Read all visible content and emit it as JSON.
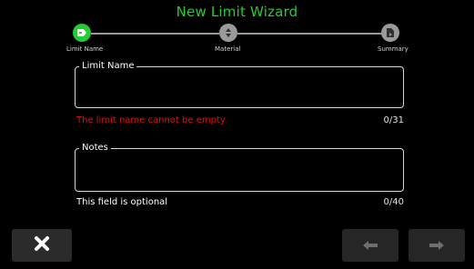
{
  "wizard": {
    "title": "New Limit Wizard",
    "steps": [
      {
        "label": "Limit Name",
        "icon": "tag-icon",
        "state": "active"
      },
      {
        "label": "Material",
        "icon": "material-icon",
        "state": "inactive"
      },
      {
        "label": "Summary",
        "icon": "summary-icon",
        "state": "inactive"
      }
    ]
  },
  "form": {
    "limit_name": {
      "label": "Limit Name",
      "value": "",
      "error": "The limit name cannot be empty",
      "counter": "0/31"
    },
    "notes": {
      "label": "Notes",
      "value": "",
      "hint": "This field is optional",
      "counter": "0/40"
    }
  },
  "footer": {
    "cancel_icon": "close-icon",
    "back_icon": "arrow-left-icon",
    "next_icon": "arrow-right-icon"
  },
  "colors": {
    "accent_green": "#22cc33",
    "error_red": "#e01010",
    "inactive_step": "#9a9a9a",
    "button_bg": "#2b2b2b"
  }
}
